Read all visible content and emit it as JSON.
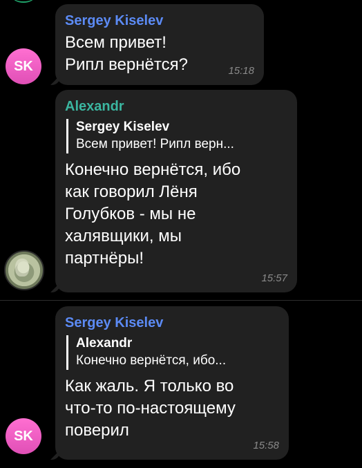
{
  "messages": [
    {
      "sender": "Sergey Kiselev",
      "lines": [
        "Всем привет!",
        "Рипл вернётся?"
      ],
      "time": "15:18",
      "avatar_initials": "SK"
    },
    {
      "sender": "Alexandr",
      "reply": {
        "name": "Sergey Kiselev",
        "text": "Всем привет! Рипл верн..."
      },
      "lines": [
        "Конечно вернётся, ибо",
        "как говорил Лёня",
        "Голубков - мы не",
        "халявщики, мы",
        "партнёры!"
      ],
      "time": "15:57"
    },
    {
      "sender": "Sergey Kiselev",
      "reply": {
        "name": "Alexandr",
        "text": "Конечно вернётся, ибо..."
      },
      "lines": [
        "Как жаль. Я только во",
        "что-то по-настоящему",
        "поверил"
      ],
      "time": "15:58",
      "avatar_initials": "SK"
    }
  ],
  "colors": {
    "background": "#000000",
    "bubble": "#212121",
    "sender_blue": "#5c8bf5",
    "sender_green": "#3bb6a0",
    "avatar_pink": "#e04fb6",
    "time": "#8a8a8a"
  }
}
